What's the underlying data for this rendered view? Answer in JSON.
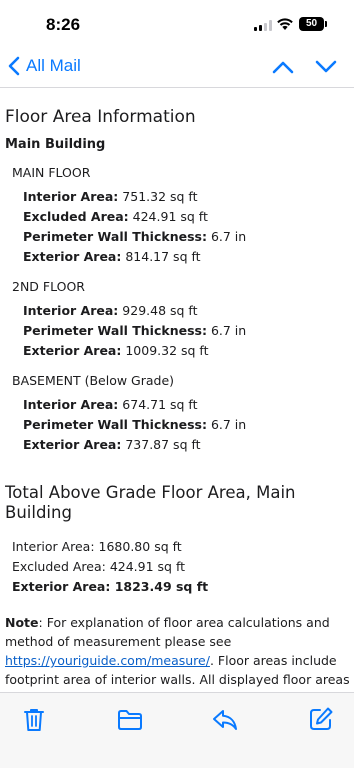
{
  "status": {
    "time": "8:26",
    "battery": "50"
  },
  "nav": {
    "back_label": "All Mail"
  },
  "email": {
    "title": "Floor Area Information",
    "building": "Main Building",
    "floors": [
      {
        "label": "MAIN FLOOR",
        "rows": [
          {
            "label": "Interior Area:",
            "value": "751.32 sq ft"
          },
          {
            "label": "Excluded Area:",
            "value": "424.91 sq ft"
          },
          {
            "label": "Perimeter Wall Thickness:",
            "value": "6.7 in"
          },
          {
            "label": "Exterior Area:",
            "value": "814.17 sq ft"
          }
        ]
      },
      {
        "label": "2ND FLOOR",
        "rows": [
          {
            "label": "Interior Area:",
            "value": "929.48 sq ft"
          },
          {
            "label": "Perimeter Wall Thickness:",
            "value": "6.7 in"
          },
          {
            "label": "Exterior Area:",
            "value": "1009.32 sq ft"
          }
        ]
      },
      {
        "label": "BASEMENT (Below Grade)",
        "rows": [
          {
            "label": "Interior Area:",
            "value": "674.71 sq ft"
          },
          {
            "label": "Perimeter Wall Thickness:",
            "value": "6.7 in"
          },
          {
            "label": "Exterior Area:",
            "value": "737.87 sq ft"
          }
        ]
      }
    ],
    "total_title": "Total Above Grade Floor Area, Main Building",
    "totals": [
      {
        "text": "Interior Area: 1680.80 sq ft",
        "bold": false
      },
      {
        "text": "Excluded Area: 424.91 sq ft",
        "bold": false
      },
      {
        "text": "Exterior Area: 1823.49 sq ft",
        "bold": true
      }
    ],
    "note": {
      "label": "Note",
      "text_before": ": For explanation of floor area calculations and method of measurement please see ",
      "link": "https://youriguide.com/measure/",
      "text_after": ". Floor areas include footprint area of interior walls. All displayed floor areas are rounded to two decimal places. Total area"
    }
  },
  "toolbar": {
    "icons": [
      "trash-icon",
      "folder-icon",
      "reply-icon",
      "compose-icon"
    ]
  },
  "colors": {
    "accent": "#0a7aff",
    "link": "#0a60c9",
    "text": "#1c1c1e"
  }
}
